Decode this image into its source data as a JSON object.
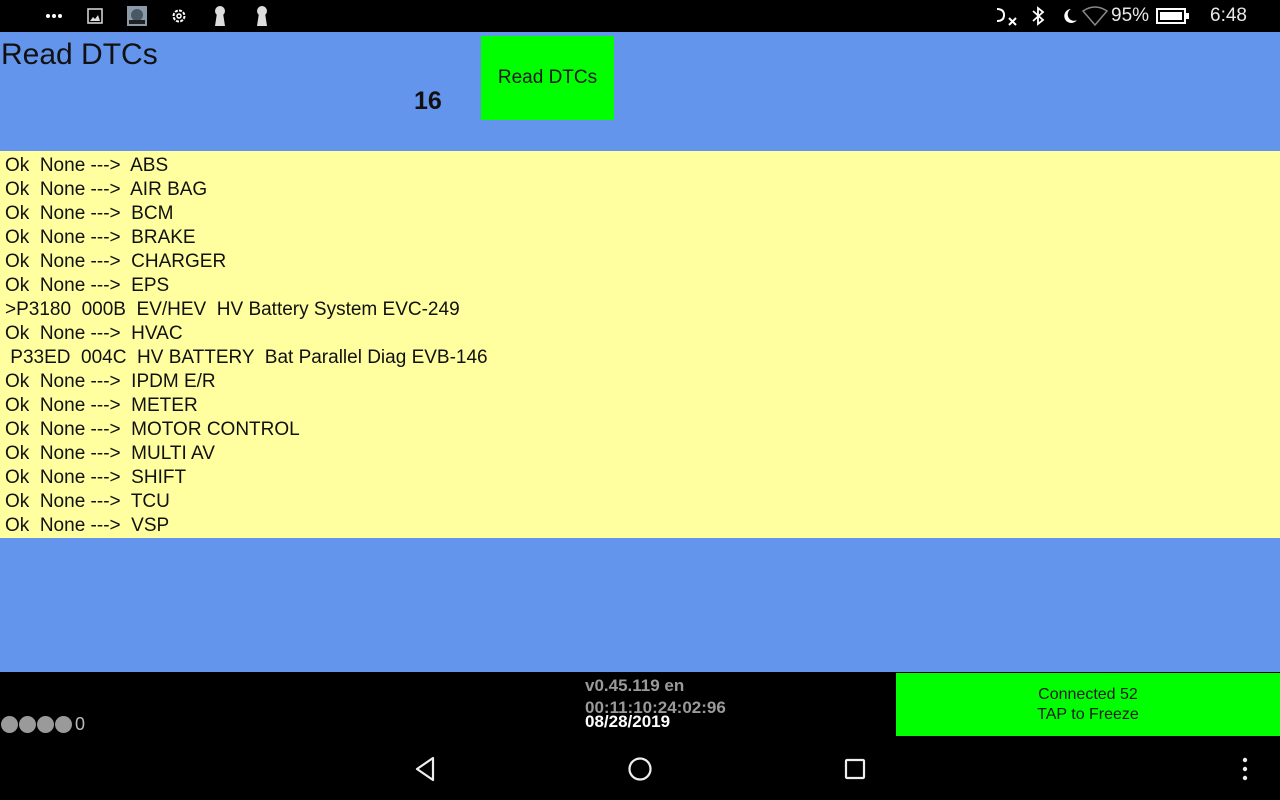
{
  "status_bar": {
    "left_icons": [
      "more-notifications-icon",
      "image-icon",
      "photo-app-icon",
      "settings-icon",
      "keyhole-icon",
      "keyhole-icon"
    ],
    "right_icons": [
      "nfc-off-icon",
      "bluetooth-icon",
      "do-not-disturb-moon-icon",
      "wifi-icon"
    ],
    "battery_percent": "95%",
    "battery_level": 0.95,
    "time": "6:48"
  },
  "header": {
    "title": "Read DTCs",
    "count": "16",
    "read_button_label": "Read DTCs"
  },
  "dtc_list": [
    {
      "text": "Ok  None --->  ABS"
    },
    {
      "text": "Ok  None --->  AIR BAG"
    },
    {
      "text": "Ok  None --->  BCM"
    },
    {
      "text": "Ok  None --->  BRAKE"
    },
    {
      "text": "Ok  None --->  CHARGER"
    },
    {
      "text": "Ok  None --->  EPS"
    },
    {
      "text": ">P3180  000B  EV/HEV  HV Battery System EVC-249"
    },
    {
      "text": "Ok  None --->  HVAC"
    },
    {
      "text": " P33ED  004C  HV BATTERY  Bat Parallel Diag EVB-146"
    },
    {
      "text": "Ok  None --->  IPDM E/R"
    },
    {
      "text": "Ok  None --->  METER"
    },
    {
      "text": "Ok  None --->  MOTOR CONTROL"
    },
    {
      "text": "Ok  None --->  MULTI AV"
    },
    {
      "text": "Ok  None --->  SHIFT"
    },
    {
      "text": "Ok  None --->  TCU"
    },
    {
      "text": "Ok  None --->  VSP"
    }
  ],
  "footer": {
    "indicator_dots": 4,
    "indicator_count": "0",
    "version": "v0.45.119 en",
    "uptime": "00:11:10:24:02:96",
    "date": "08/28/2019",
    "connection_line1": "Connected 52",
    "connection_line2": "TAP to Freeze"
  },
  "nav_bar": {
    "buttons": [
      "back-icon",
      "home-icon",
      "recents-icon",
      "overflow-menu-icon"
    ]
  },
  "colors": {
    "header_bg": "#6495ED",
    "list_bg": "#FFFFA0",
    "button_green": "#00FF00"
  }
}
